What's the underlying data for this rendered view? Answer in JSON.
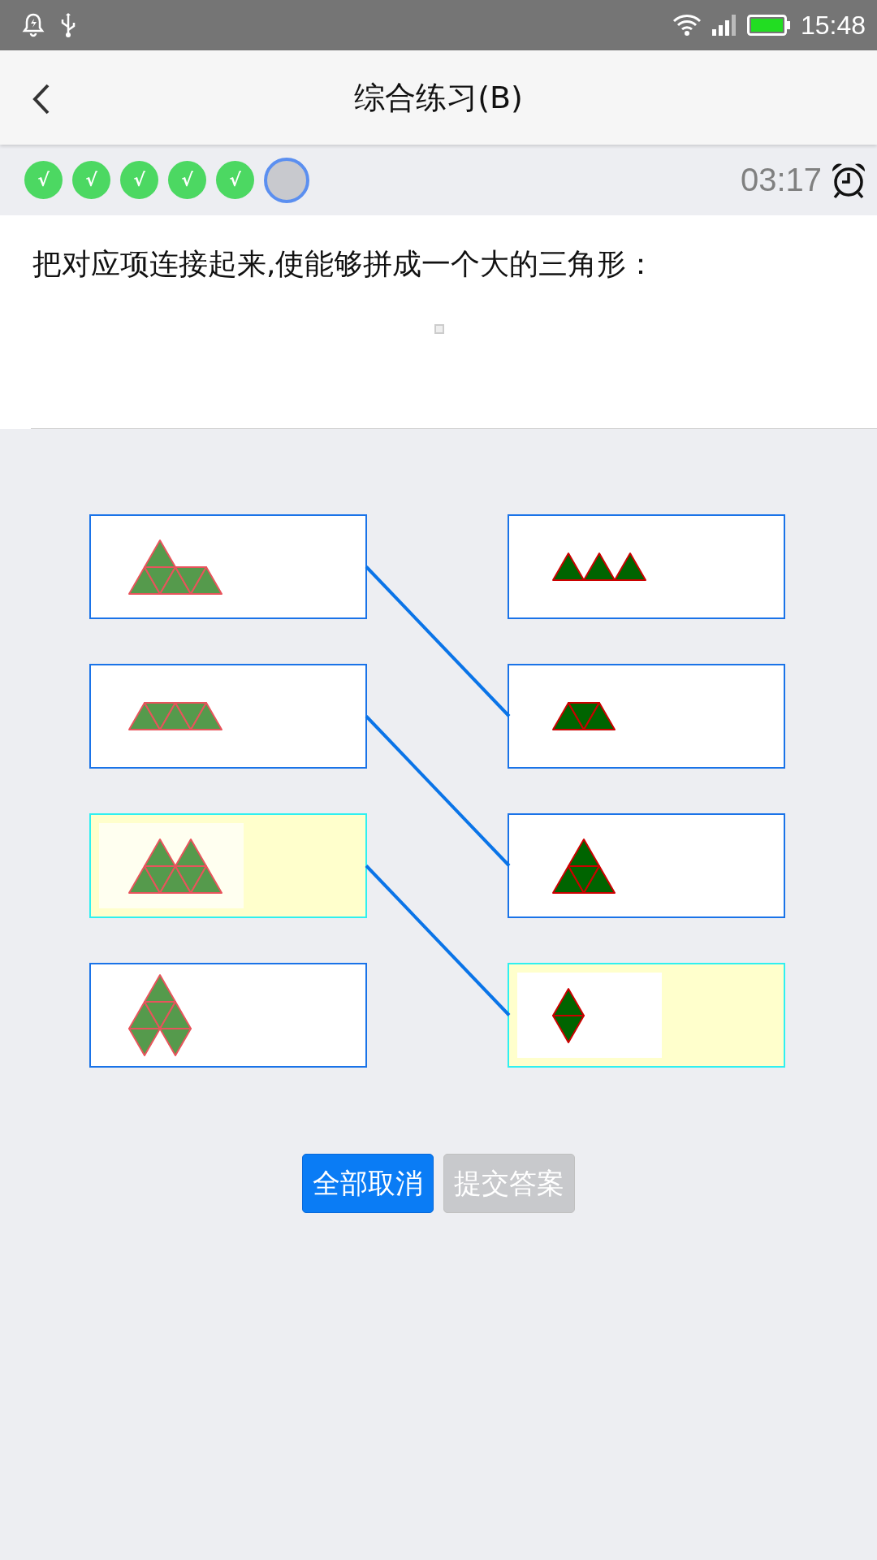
{
  "status_bar": {
    "time": "15:48"
  },
  "header": {
    "title": "综合练习(B)"
  },
  "progress": [
    {
      "label": "√",
      "answered": true,
      "current": false
    },
    {
      "label": "√",
      "answered": true,
      "current": false
    },
    {
      "label": "√",
      "answered": true,
      "current": false
    },
    {
      "label": "√",
      "answered": true,
      "current": false
    },
    {
      "label": "√",
      "answered": true,
      "current": false
    },
    {
      "answered": false,
      "current": true
    }
  ],
  "timer": "03:17",
  "question": {
    "text": "把对应项连接起来,使能够拼成一个大的三角形："
  },
  "left_items": [
    {
      "kind": "tower",
      "selected": false,
      "linked": true
    },
    {
      "kind": "strip",
      "selected": false,
      "linked": true
    },
    {
      "kind": "twin-peaks",
      "selected": true,
      "linked": true
    },
    {
      "kind": "kite",
      "selected": false,
      "linked": false
    }
  ],
  "right_items": [
    {
      "kind": "three-peaks",
      "selected": false,
      "linked": false
    },
    {
      "kind": "trapezoid",
      "selected": false,
      "linked": true
    },
    {
      "kind": "triangle",
      "selected": false,
      "linked": true
    },
    {
      "kind": "diamond",
      "selected": true,
      "linked": true
    }
  ],
  "buttons": [
    {
      "label": "全部取消",
      "disabled": false
    },
    {
      "label": "提交答案",
      "disabled": true
    }
  ]
}
